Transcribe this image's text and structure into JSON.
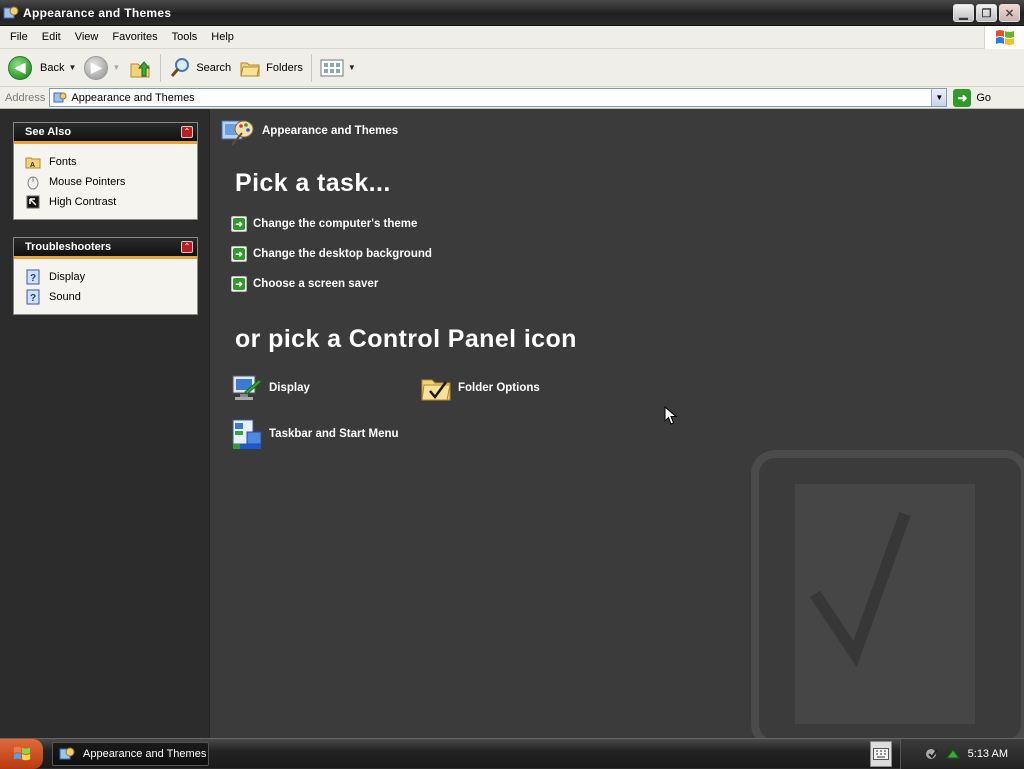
{
  "window": {
    "title": "Appearance and Themes"
  },
  "menubar": {
    "items": [
      "File",
      "Edit",
      "View",
      "Favorites",
      "Tools",
      "Help"
    ]
  },
  "toolbar": {
    "back": "Back",
    "search": "Search",
    "folders": "Folders"
  },
  "address": {
    "label": "Address",
    "value": "Appearance and Themes",
    "go": "Go"
  },
  "see_also": {
    "title": "See Also",
    "items": [
      "Fonts",
      "Mouse Pointers",
      "High Contrast"
    ]
  },
  "troubleshooters": {
    "title": "Troubleshooters",
    "items": [
      "Display",
      "Sound"
    ]
  },
  "main": {
    "heading": "Appearance and Themes",
    "pick_task": "Pick a task...",
    "tasks": [
      "Change the computer's theme",
      "Change the desktop background",
      "Choose a screen saver"
    ],
    "pick_icon": "or pick a Control Panel icon",
    "icons": [
      "Display",
      "Folder Options",
      "Taskbar and Start Menu"
    ]
  },
  "taskbar": {
    "task_label": "Appearance and Themes",
    "clock": "5:13 AM"
  },
  "colors": {
    "accent_orange": "#e8a33a",
    "go_green": "#2f9a2a",
    "content_bg": "#3b3b3b"
  }
}
